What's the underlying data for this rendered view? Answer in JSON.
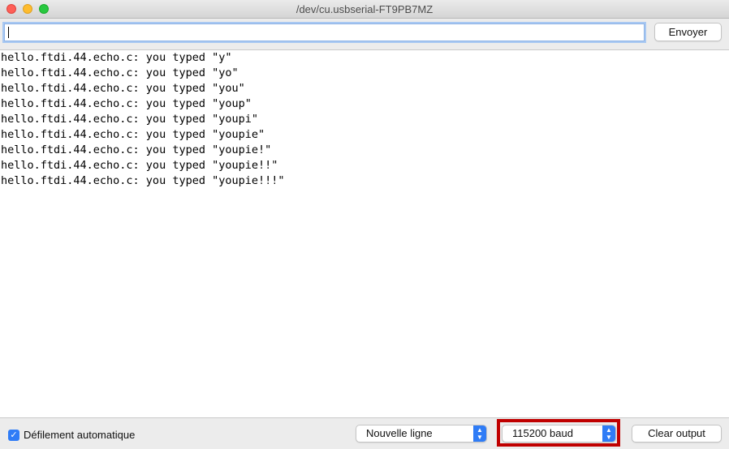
{
  "window": {
    "title": "/dev/cu.usbserial-FT9PB7MZ"
  },
  "toolbar": {
    "input_value": "",
    "send_label": "Envoyer"
  },
  "output": {
    "lines": [
      "hello.ftdi.44.echo.c: you typed \"y\"",
      "hello.ftdi.44.echo.c: you typed \"yo\"",
      "hello.ftdi.44.echo.c: you typed \"you\"",
      "hello.ftdi.44.echo.c: you typed \"youp\"",
      "hello.ftdi.44.echo.c: you typed \"youpi\"",
      "hello.ftdi.44.echo.c: you typed \"youpie\"",
      "hello.ftdi.44.echo.c: you typed \"youpie!\"",
      "hello.ftdi.44.echo.c: you typed \"youpie!!\"",
      "hello.ftdi.44.echo.c: you typed \"youpie!!!\""
    ]
  },
  "footer": {
    "autoscroll_checked": true,
    "autoscroll_label": "Défilement automatique",
    "line_ending_value": "Nouvelle ligne",
    "baud_value": "115200  baud",
    "clear_label": "Clear output"
  },
  "colors": {
    "accent": "#2f7cf6",
    "highlight_box": "#c00000"
  },
  "icons": {
    "checkbox": "check-icon",
    "select_stepper": "up-down-chevron-icon"
  }
}
